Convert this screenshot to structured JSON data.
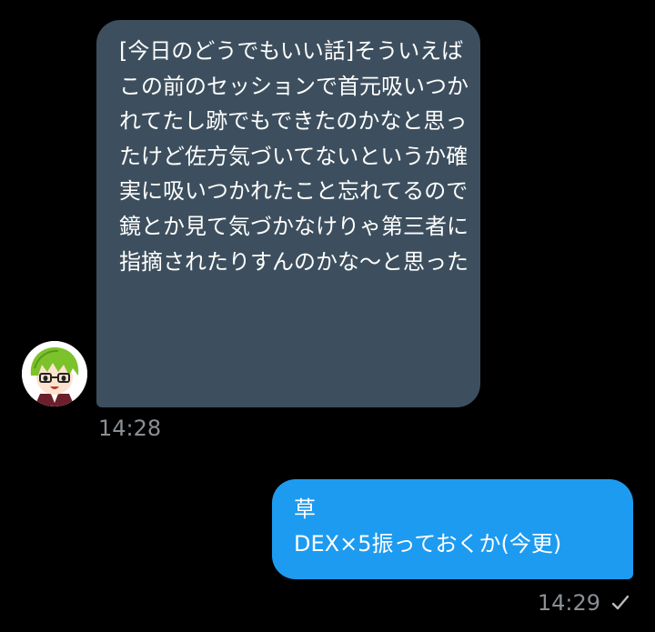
{
  "thread": {
    "incoming": {
      "avatar_icon": "green-haired-character-avatar",
      "text": "[今日のどうでもいい話]そういえばこの前のセッションで首元吸いつかれてたし跡でもできたのかなと思ったけど佐方気づいてないというか確実に吸いつかれたこと忘れてるので鏡とか見て気づかなけりゃ第三者に指摘されたりすんのかな〜と思った",
      "time": "14:28",
      "bubble_color": "#3d4f5e"
    },
    "outgoing": {
      "text": "草\nDEX×5振っておくか(今更)",
      "time": "14:29",
      "status_icon": "checkmark-icon",
      "bubble_color": "#1d9bf0"
    }
  }
}
